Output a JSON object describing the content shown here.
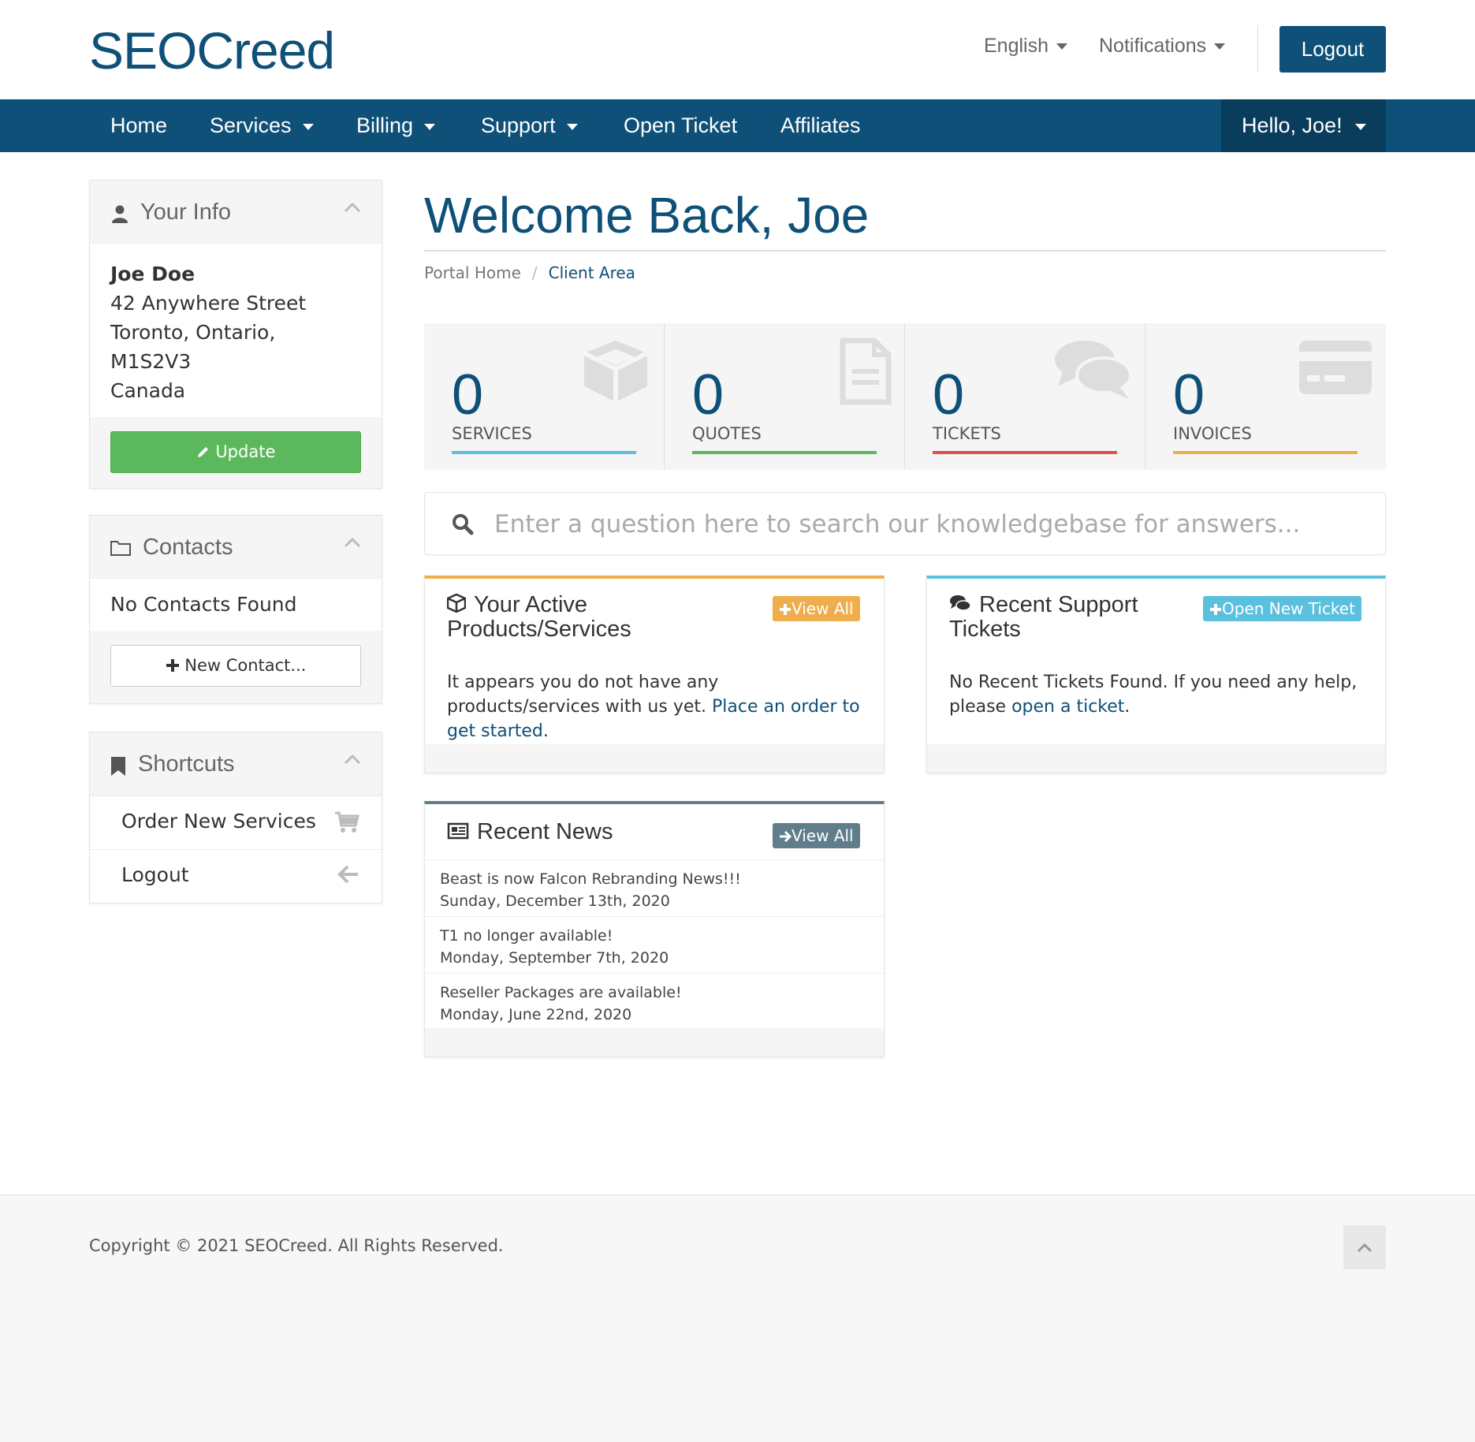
{
  "header": {
    "logo": "SEOCreed",
    "language": "English",
    "notifications": "Notifications",
    "logout": "Logout"
  },
  "nav": {
    "items": [
      "Home",
      "Services",
      "Billing",
      "Support",
      "Open Ticket",
      "Affiliates"
    ],
    "user": "Hello, Joe!"
  },
  "sidebar": {
    "your_info": {
      "title": "Your Info",
      "name": "Joe Doe",
      "address_lines": [
        "42 Anywhere Street",
        "Toronto, Ontario,",
        "M1S2V3",
        "Canada"
      ],
      "update_label": "Update"
    },
    "contacts": {
      "title": "Contacts",
      "empty": "No Contacts Found",
      "new_label": "New Contact..."
    },
    "shortcuts": {
      "title": "Shortcuts",
      "items": [
        "Order New Services",
        "Logout"
      ]
    }
  },
  "main": {
    "welcome": "Welcome Back, Joe",
    "breadcrumb": [
      "Portal Home",
      "Client Area"
    ],
    "tiles": [
      {
        "count": "0",
        "label": "SERVICES",
        "color": "#5bc0de"
      },
      {
        "count": "0",
        "label": "QUOTES",
        "color": "#5cb85c"
      },
      {
        "count": "0",
        "label": "TICKETS",
        "color": "#d9534f"
      },
      {
        "count": "0",
        "label": "INVOICES",
        "color": "#f0ad4e"
      }
    ],
    "kb_placeholder": "Enter a question here to search our knowledgebase for answers...",
    "products": {
      "title_line1": "Your Active",
      "title_line2": "Products/Services",
      "button": "View All",
      "body_text": "It appears you do not have any products/services with us yet.",
      "link": "Place an order to get started",
      "after": "."
    },
    "tickets": {
      "title_line1": "Recent Support",
      "title_line2": "Tickets",
      "button": "Open New Ticket",
      "body_text": "No Recent Tickets Found. If you need any help, please",
      "link": "open a ticket",
      "after": "."
    },
    "news": {
      "title": "Recent News",
      "button": "View All",
      "items": [
        {
          "title": "Beast is now Falcon Rebranding News!!!",
          "date": "Sunday, December 13th, 2020"
        },
        {
          "title": "T1 no longer available!",
          "date": "Monday, September 7th, 2020"
        },
        {
          "title": "Reseller Packages are available!",
          "date": "Monday, June 22nd, 2020"
        }
      ]
    }
  },
  "footer": {
    "copyright": "Copyright © 2021 SEOCreed. All Rights Reserved."
  },
  "colors": {
    "brand": "#0e5077",
    "success": "#5cb85c",
    "warning": "#f0ad4e",
    "info": "#5bc0de",
    "danger": "#d9534f"
  }
}
